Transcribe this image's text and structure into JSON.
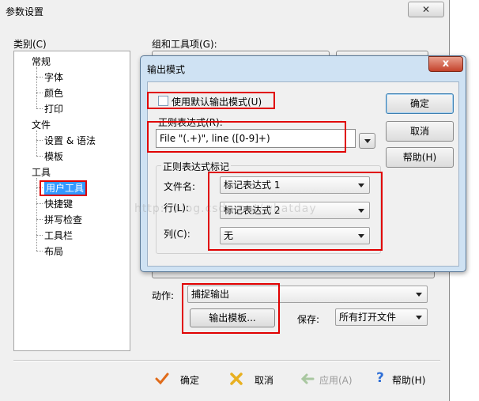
{
  "main_window": {
    "title": "参数设置",
    "close_glyph": "✕",
    "category_label": "类别(C)",
    "combo_label": "组和工具项(G):",
    "tree": [
      {
        "label": "常规",
        "level": 0
      },
      {
        "label": "字体",
        "level": 1
      },
      {
        "label": "颜色",
        "level": 1
      },
      {
        "label": "打印",
        "level": 1
      },
      {
        "label": "文件",
        "level": 0
      },
      {
        "label": "设置 & 语法",
        "level": 1
      },
      {
        "label": "模板",
        "level": 1
      },
      {
        "label": "工具",
        "level": 0
      },
      {
        "label": "用户工具",
        "level": 1,
        "selected": true
      },
      {
        "label": "快捷键",
        "level": 1
      },
      {
        "label": "拼写检查",
        "level": 1
      },
      {
        "label": "工具栏",
        "level": 1
      },
      {
        "label": "布局",
        "level": 1
      }
    ],
    "action_label": "动作:",
    "action_value": "捕捉输出",
    "output_template_button": "输出模板...",
    "save_label": "保存:",
    "save_value": "所有打开文件",
    "footer": {
      "ok": "确定",
      "cancel": "取消",
      "apply": "应用(A)",
      "help": "帮助(H)"
    }
  },
  "dialog": {
    "title": "输出模式",
    "close_glyph": "x",
    "use_default_checkbox": "使用默认输出模式(U)",
    "use_default_checked": false,
    "regex_label": "正则表达式(R):",
    "regex_value": "File \"(.+)\", line ([0-9]+)",
    "group_label": "正则表达式标记",
    "filename_label": "文件名:",
    "filename_value": "标记表达式 1",
    "line_label": "行(L):",
    "line_value": "标记表达式 2",
    "column_label": "列(C):",
    "column_value": "无",
    "ok_button": "确定",
    "cancel_button": "取消",
    "help_button": "帮助(H)"
  },
  "watermark": "http://blog.csdn.net/whatday",
  "colors": {
    "highlight_red": "#e00000",
    "selected_bg": "#3399ff",
    "dialog_frame": "#cfe2f3"
  }
}
